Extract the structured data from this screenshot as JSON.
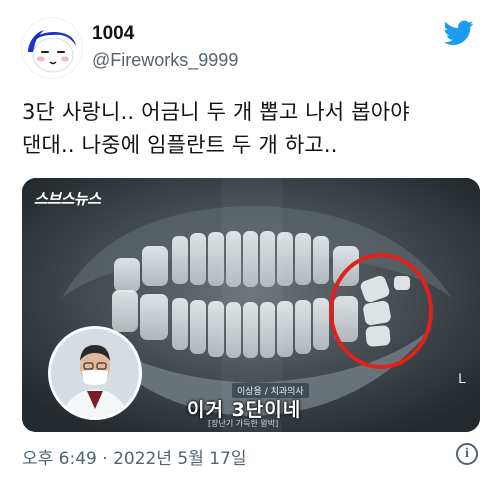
{
  "author": {
    "display_name": "1004",
    "handle": "@Fireworks_9999"
  },
  "brand_color": "#1d9bf0",
  "tweet": {
    "lines": [
      "3단 사랑니.. 어금니 두 개 뽑고 나서 봅아야",
      "댄대.. 나중에 임플란트 두 개 하고.."
    ]
  },
  "media": {
    "channel_logo": "스브스뉴스",
    "name_caption": "이상용 / 치과의사",
    "subtitle": "이거 3단이네",
    "credit": "[장난기 가득한 왕박]",
    "side_marker": "L",
    "highlight_color": "#e0201b"
  },
  "footer": {
    "timestamp": "오후 6:49 · 2022년 5월 17일",
    "info_icon": "i"
  },
  "icons": {
    "avatar": "cartoon-face-icon",
    "brand": "twitter-bird-icon",
    "info": "info-icon"
  }
}
